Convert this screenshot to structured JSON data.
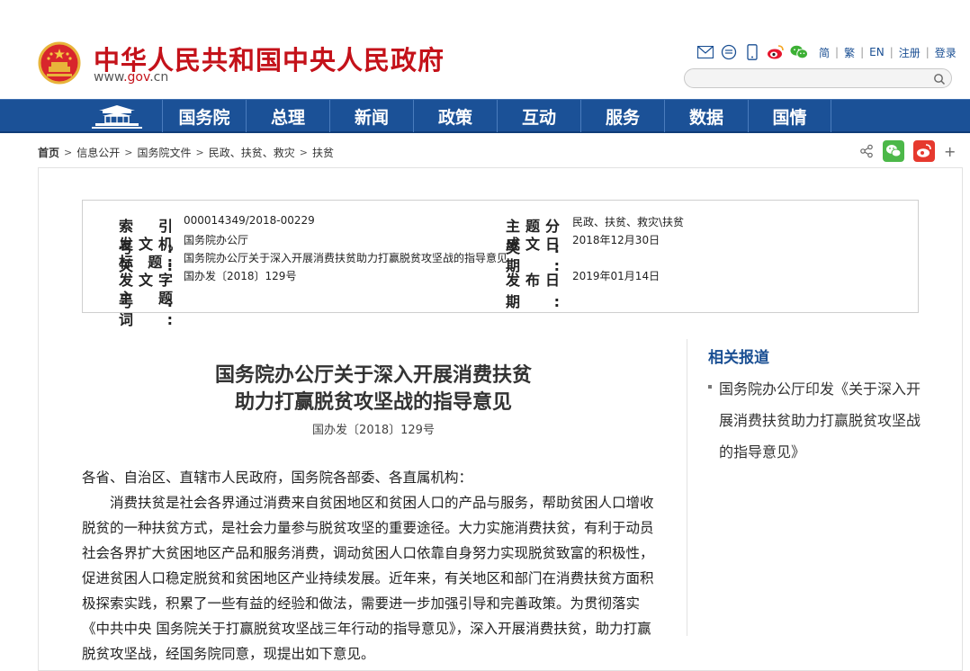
{
  "header": {
    "site_title": "中华人民共和国中央人民政府",
    "site_url_pre": "www",
    "site_url_gov": "gov",
    "site_url_cn": "cn",
    "lang_links": [
      "简",
      "繁",
      "EN",
      "注册",
      "登录"
    ],
    "search_placeholder": ""
  },
  "nav": {
    "items": [
      "国务院",
      "总理",
      "新闻",
      "政策",
      "互动",
      "服务",
      "数据",
      "国情"
    ]
  },
  "breadcrumb": {
    "items": [
      "首页",
      "信息公开",
      "国务院文件",
      "民政、扶贫、救灾",
      "扶贫"
    ]
  },
  "meta": {
    "index_label": "索 引 号:",
    "index_value": "000014349/2018-00229",
    "category_label": "主题分类:",
    "category_value": "民政、扶贫、救灾\\扶贫",
    "issuer_label": "发文机关:",
    "issuer_value": "国务院办公厅",
    "written_label": "成文日期:",
    "written_value": "2018年12月30日",
    "title_label": "标    题:",
    "title_value": "国务院办公厅关于深入开展消费扶贫助力打赢脱贫攻坚战的指导意见",
    "docno_label": "发文字号:",
    "docno_value": "国办发〔2018〕129号",
    "published_label": "发布日期:",
    "published_value": "2019年01月14日",
    "keywords_label": "主 题 词:",
    "keywords_value": ""
  },
  "article": {
    "title_line1": "国务院办公厅关于深入开展消费扶贫",
    "title_line2": "助力打赢脱贫攻坚战的指导意见",
    "doc_no": "国办发〔2018〕129号",
    "salutation": "各省、自治区、直辖市人民政府，国务院各部委、各直属机构：",
    "paragraph1": "消费扶贫是社会各界通过消费来自贫困地区和贫困人口的产品与服务，帮助贫困人口增收脱贫的一种扶贫方式，是社会力量参与脱贫攻坚的重要途径。大力实施消费扶贫，有利于动员社会各界扩大贫困地区产品和服务消费，调动贫困人口依靠自身努力实现脱贫致富的积极性，促进贫困人口稳定脱贫和贫困地区产业持续发展。近年来，有关地区和部门在消费扶贫方面积极探索实践，积累了一些有益的经验和做法，需要进一步加强引导和完善政策。为贯彻落实《中共中央 国务院关于打赢脱贫攻坚战三年行动的指导意见》，深入开展消费扶贫，助力打赢脱贫攻坚战，经国务院同意，现提出如下意见。"
  },
  "sidebar": {
    "title": "相关报道",
    "link": "国务院办公厅印发《关于深入开展消费扶贫助力打赢脱贫攻坚战的指导意见》"
  },
  "colors": {
    "brand_red": "#c4121a",
    "nav_blue": "#1b5197",
    "link_blue": "#1a4f93"
  }
}
